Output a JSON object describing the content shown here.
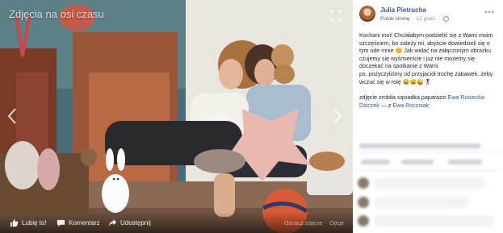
{
  "photo": {
    "album_title": "Zdjęcia na osi czasu",
    "actions": {
      "like": "Lubię to!",
      "comment": "Komentarz",
      "share": "Udostępnij"
    },
    "options": {
      "tag": "Oznacz zdjęcie",
      "options": "Opcje"
    }
  },
  "post": {
    "author": "Julia Pietrucha",
    "liked_page": "Polub stronę",
    "time": "12 godz.",
    "text_lines": [
      "Kochani moi! Chciałabym podzielić się z Wami moim",
      "szczęściem, bo zależy mi, abyście dowiedzieli się o",
      "tym ode mnie 😊 Jak widać na załączonym obrazku",
      "czujemy się wyśmienicie i już nie możemy się",
      "doczekać na spotkanie z Wami.",
      "ps. pożyczyliśmy od przyjaciół trochę zabawek, żeby",
      "wczuć się w rolę 😄😄😜🎖"
    ],
    "credit_prefix": "zdjęcie zrobiła sąsiadka paparazzi",
    "credit_name": "Ewa Rusiecka-Dziczek",
    "credit_sep": " — z ",
    "credit_with": "Ewa Roczniak"
  },
  "colors": {
    "link": "#365899",
    "text": "#1d2129",
    "muted": "#90949c"
  }
}
